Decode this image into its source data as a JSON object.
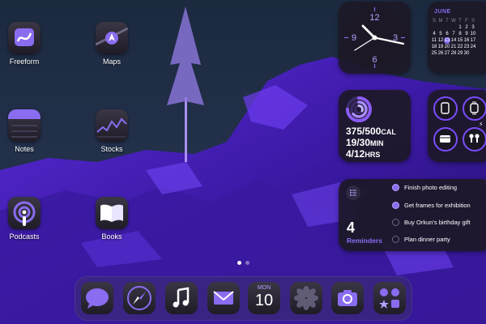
{
  "apps": [
    {
      "name": "Freeform"
    },
    {
      "name": "Maps"
    },
    {
      "name": "Notes"
    },
    {
      "name": "Stocks"
    },
    {
      "name": "Podcasts"
    },
    {
      "name": "Books"
    }
  ],
  "clock": {
    "numerals": [
      "12",
      "3",
      "6",
      "9"
    ]
  },
  "calendar": {
    "month": "JUNE",
    "weekdays": [
      "S",
      "M",
      "T",
      "W",
      "T",
      "F",
      "S"
    ],
    "rows": [
      [
        "",
        "",
        "",
        "",
        "1",
        "2",
        "3"
      ],
      [
        "4",
        "5",
        "6",
        "7",
        "8",
        "9",
        "10"
      ],
      [
        "11",
        "12",
        "13",
        "14",
        "15",
        "16",
        "17"
      ],
      [
        "18",
        "19",
        "20",
        "21",
        "22",
        "23",
        "24"
      ],
      [
        "25",
        "26",
        "27",
        "28",
        "29",
        "30",
        ""
      ]
    ],
    "today": "13"
  },
  "fitness": {
    "move": "375/500",
    "move_unit": "CAL",
    "exercise": "19/30",
    "exercise_unit": "MIN",
    "stand": "4/12",
    "stand_unit": "HRS",
    "colors": {
      "ring": "#8b5cf6",
      "ring_track": "#3b2a66"
    }
  },
  "batteries": {
    "devices": [
      "ipad-icon",
      "watch-icon",
      "case-icon",
      "airpods-icon"
    ]
  },
  "reminders": {
    "count": "4",
    "title": "Reminders",
    "items": [
      {
        "text": "Finish photo editing",
        "done": true
      },
      {
        "text": "Get frames for exhibition",
        "done": true
      },
      {
        "text": "Buy Orkun's birthday gift",
        "done": false
      },
      {
        "text": "Plan dinner party",
        "done": false
      }
    ]
  },
  "dock": {
    "calendar_day": "MON",
    "calendar_date": "10",
    "apps": [
      "messages-icon",
      "safari-icon",
      "music-icon",
      "mail-icon",
      "calendar-icon",
      "photos-icon",
      "camera-icon",
      "app-library-icon"
    ]
  },
  "page_indicator": {
    "pages": 2,
    "current": 1
  },
  "colors": {
    "accent": "#8a6cf0",
    "clock_face": "#1c1826",
    "widget_bg": "#1c1826"
  }
}
